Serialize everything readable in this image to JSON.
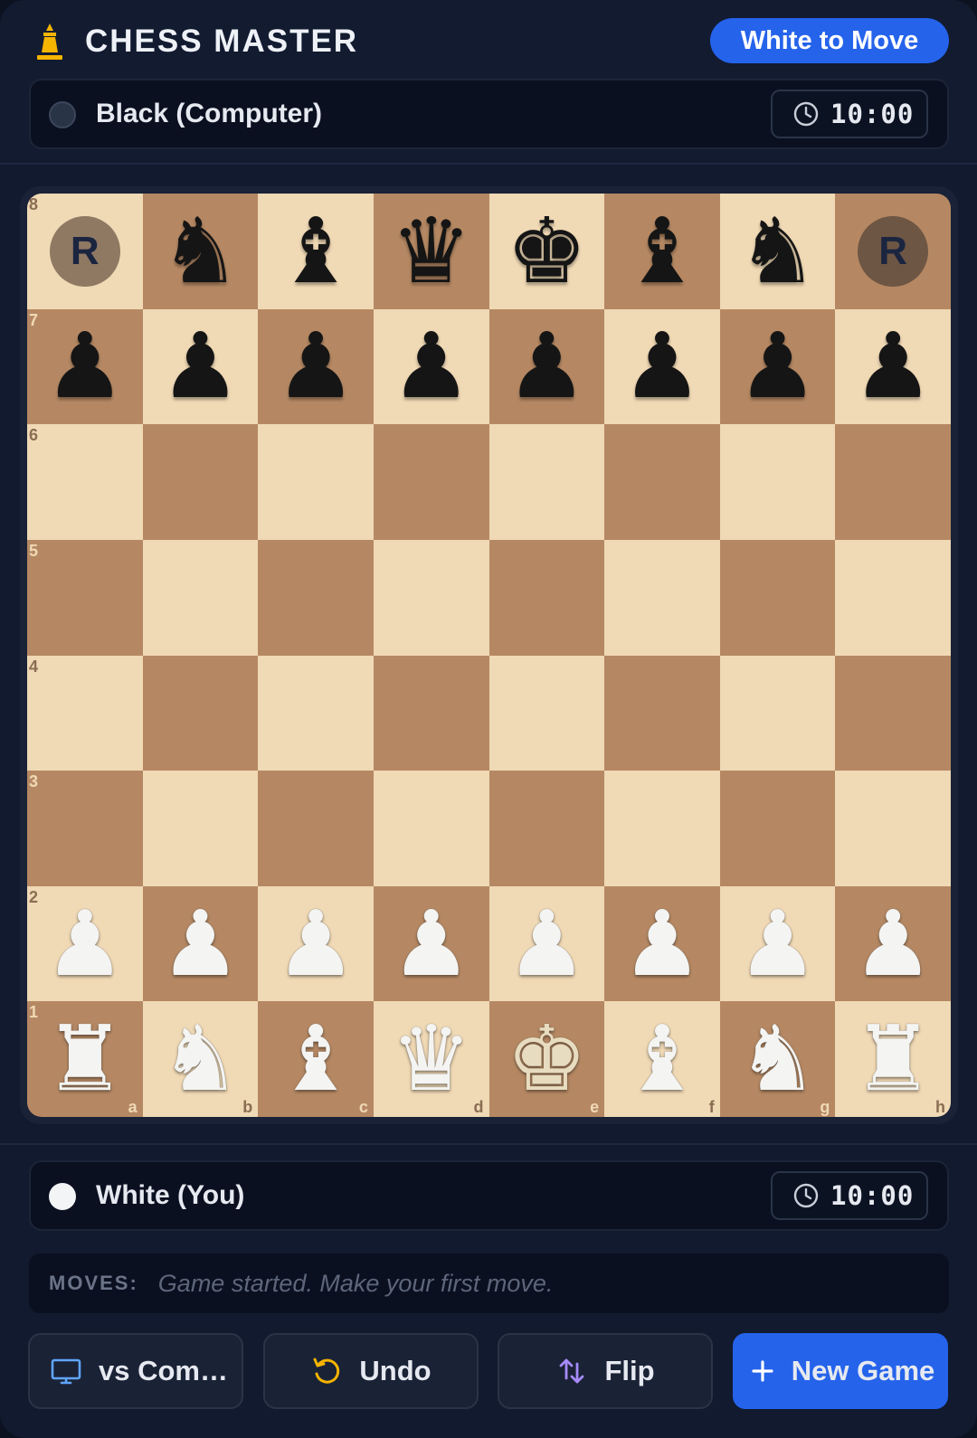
{
  "header": {
    "title": "CHESS MASTER",
    "turn_status": "White to Move"
  },
  "players": {
    "opponent": {
      "name": "Black (Computer)",
      "clock": "10:00"
    },
    "self": {
      "name": "White (You)",
      "clock": "10:00"
    }
  },
  "board": {
    "ranks": [
      "8",
      "7",
      "6",
      "5",
      "4",
      "3",
      "2",
      "1"
    ],
    "files": [
      "a",
      "b",
      "c",
      "d",
      "e",
      "f",
      "g",
      "h"
    ],
    "rows": [
      [
        "bR",
        "bN",
        "bB",
        "bQ",
        "bK",
        "bB",
        "bN",
        "bR"
      ],
      [
        "bP",
        "bP",
        "bP",
        "bP",
        "bP",
        "bP",
        "bP",
        "bP"
      ],
      [
        "",
        "",
        "",
        "",
        "",
        "",
        "",
        ""
      ],
      [
        "",
        "",
        "",
        "",
        "",
        "",
        "",
        ""
      ],
      [
        "",
        "",
        "",
        "",
        "",
        "",
        "",
        ""
      ],
      [
        "",
        "",
        "",
        "",
        "",
        "",
        "",
        ""
      ],
      [
        "wP",
        "wP",
        "wP",
        "wP",
        "wP",
        "wP",
        "wP",
        "wP"
      ],
      [
        "wR",
        "wN",
        "wB",
        "wQ",
        "wK",
        "wB",
        "wN",
        "wR"
      ]
    ],
    "rook_token_letter": "R",
    "colors": {
      "light": "#f0d9b5",
      "dark": "#b58863"
    }
  },
  "moves": {
    "label": "MOVES:",
    "text": "Game started. Make your first move."
  },
  "controls": {
    "mode_label": "vs Com…",
    "undo_label": "Undo",
    "flip_label": "Flip",
    "new_game_label": "New Game"
  },
  "icons": {
    "brand": "pawn-icon",
    "clock": "clock-icon",
    "mode": "monitor-icon",
    "undo": "undo-icon",
    "flip": "swap-vertical-icon",
    "new_game": "plus-icon"
  },
  "accent_color": "#2563eb"
}
